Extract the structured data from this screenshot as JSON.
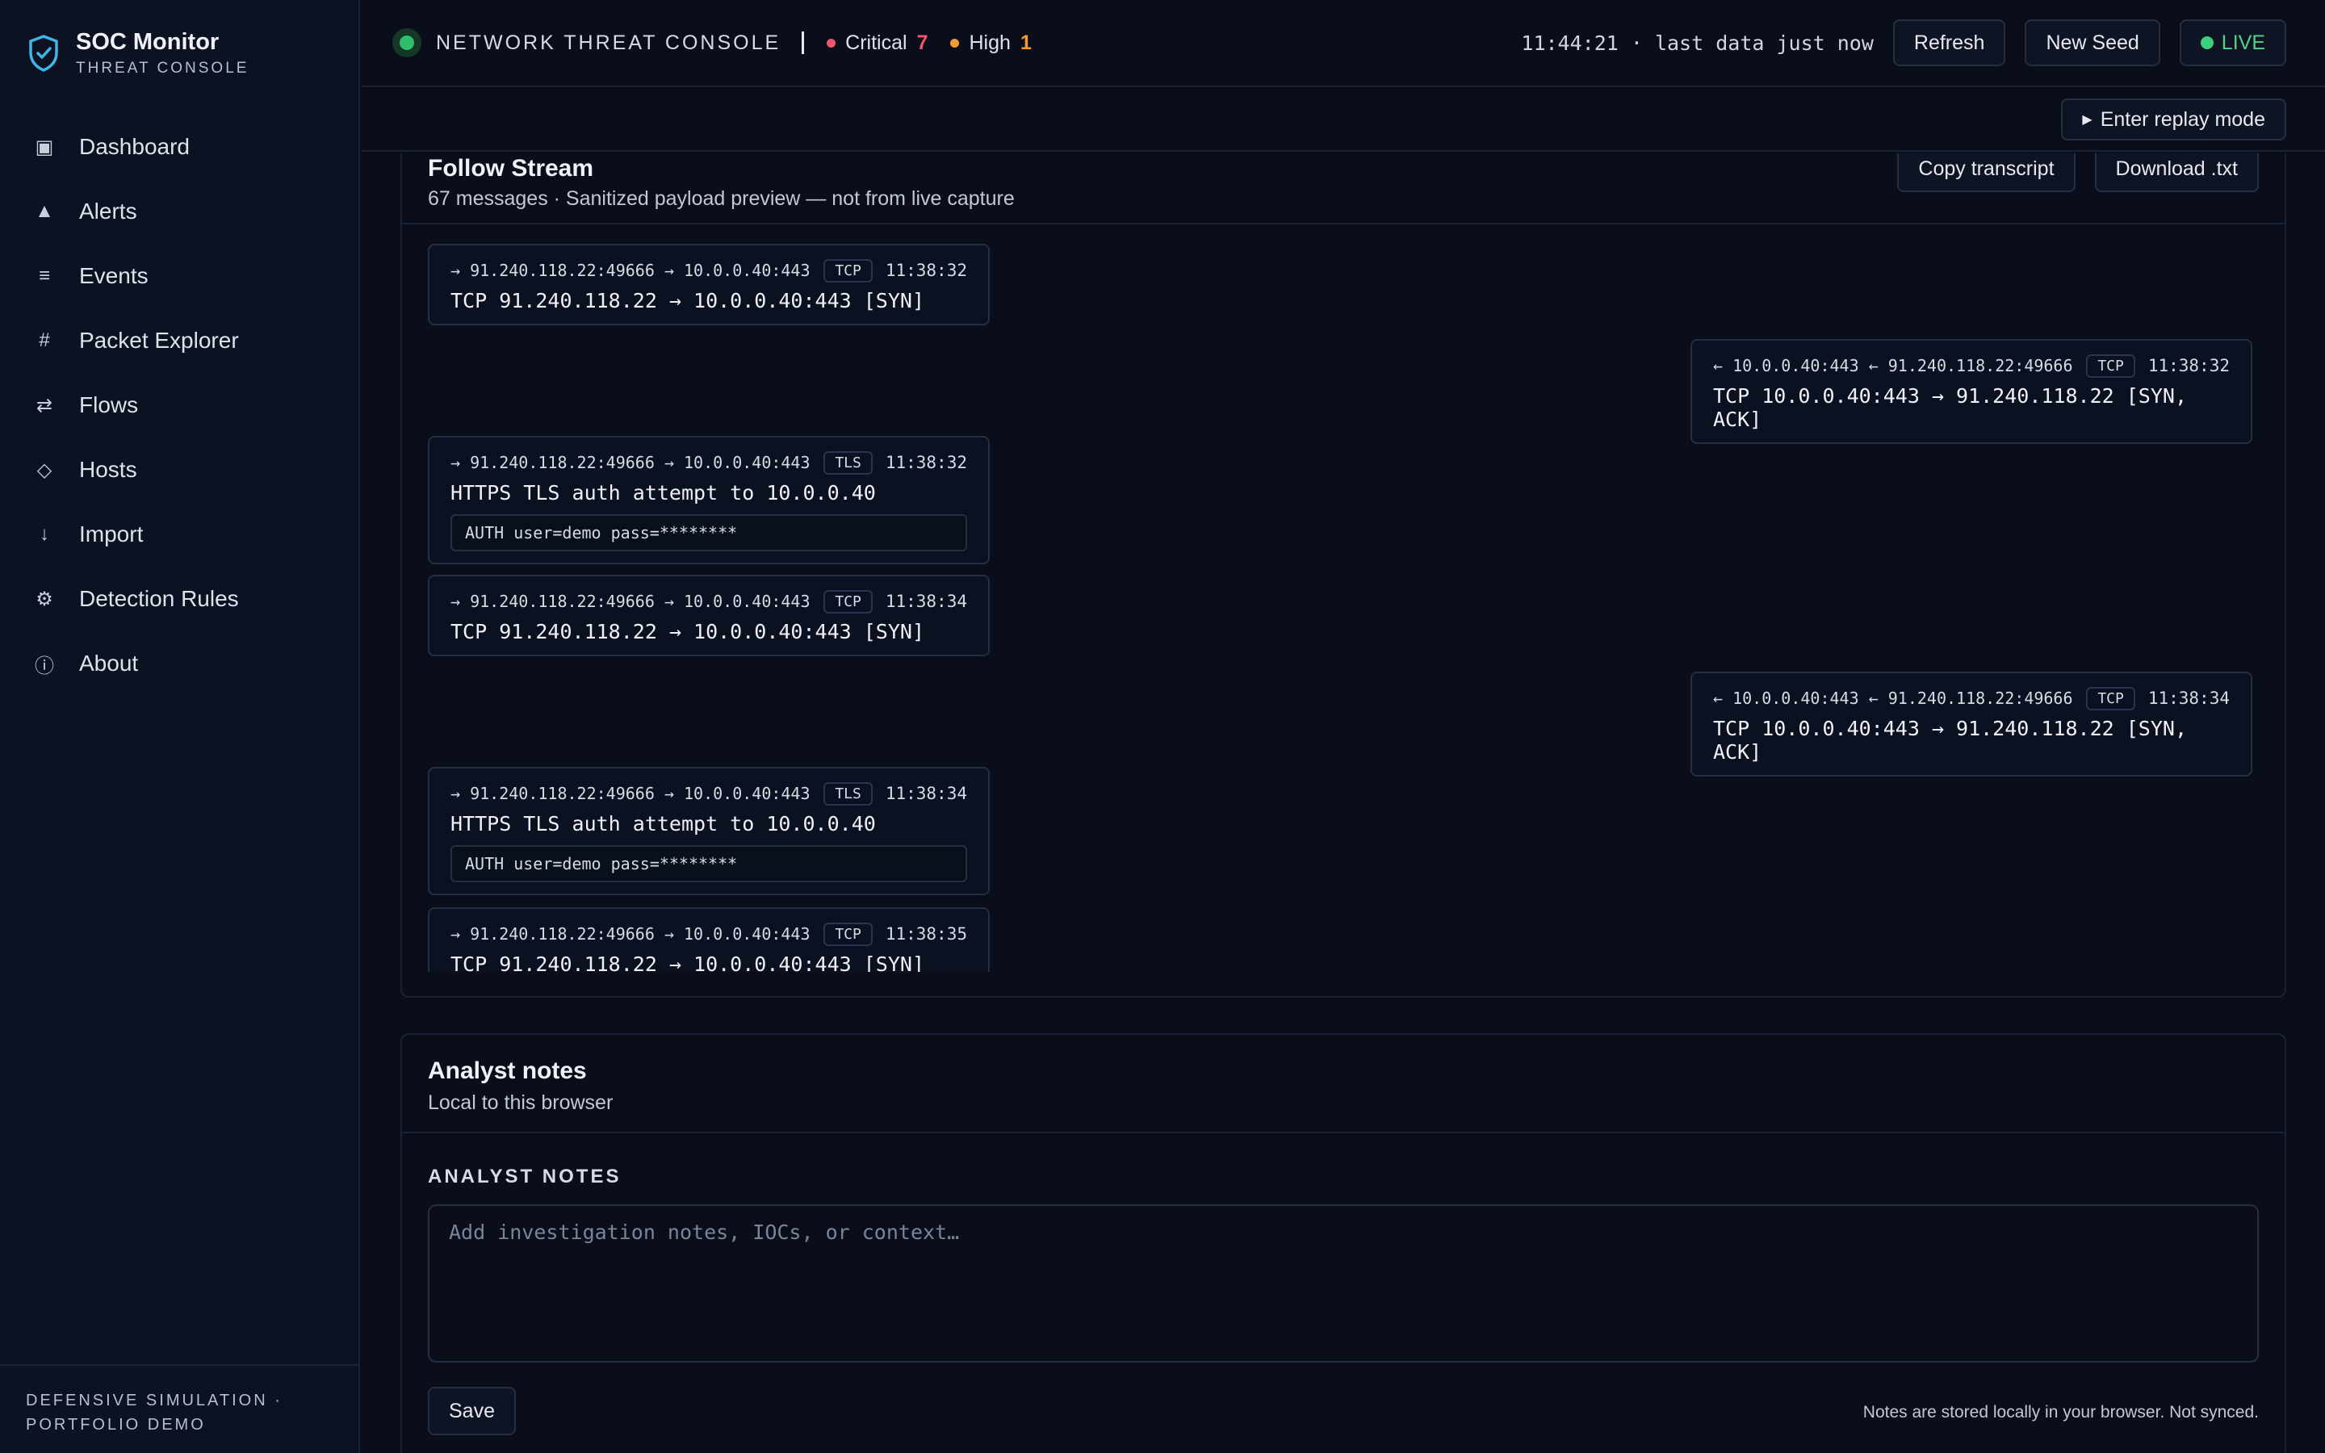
{
  "sidebar": {
    "brand_title": "SOC Monitor",
    "brand_sub": "THREAT CONSOLE",
    "items": [
      {
        "label": "Dashboard",
        "icon": "dashboard-icon"
      },
      {
        "label": "Alerts",
        "icon": "alert-triangle-icon"
      },
      {
        "label": "Events",
        "icon": "list-icon"
      },
      {
        "label": "Packet Explorer",
        "icon": "hash-icon"
      },
      {
        "label": "Flows",
        "icon": "arrows-exchange-icon"
      },
      {
        "label": "Hosts",
        "icon": "diamond-icon"
      },
      {
        "label": "Import",
        "icon": "arrow-down-icon"
      },
      {
        "label": "Detection Rules",
        "icon": "gear-icon"
      },
      {
        "label": "About",
        "icon": "info-icon"
      }
    ],
    "footer_line1": "DEFENSIVE SIMULATION ·",
    "footer_line2": "PORTFOLIO DEMO"
  },
  "topbar": {
    "title": "NETWORK THREAT CONSOLE",
    "critical_label": "Critical",
    "critical_count": "7",
    "high_label": "High",
    "high_count": "1",
    "clock": "11:44:21 · last data just now",
    "refresh_label": "Refresh",
    "new_seed_label": "New Seed",
    "live_label": "LIVE"
  },
  "replay": {
    "label": "Enter replay mode"
  },
  "stream": {
    "title": "Follow Stream",
    "subtitle": "67 messages · Sanitized payload preview — not from live capture",
    "copy_label": "Copy transcript",
    "download_label": "Download .txt",
    "messages": [
      {
        "flow": "→ 91.240.118.22:49666 → 10.0.0.40:443",
        "proto": "TCP",
        "time": "11:38:32",
        "text": "TCP 91.240.118.22 → 10.0.0.40:443 [SYN]",
        "payload": ""
      },
      {
        "flow": "← 10.0.0.40:443 ← 91.240.118.22:49666",
        "proto": "TCP",
        "time": "11:38:32",
        "text": "TCP 10.0.0.40:443 → 91.240.118.22 [SYN, ACK]",
        "payload": ""
      },
      {
        "flow": "→ 91.240.118.22:49666 → 10.0.0.40:443",
        "proto": "TLS",
        "time": "11:38:32",
        "text": "HTTPS TLS auth attempt to 10.0.0.40",
        "payload": "AUTH user=demo pass=********"
      },
      {
        "flow": "→ 91.240.118.22:49666 → 10.0.0.40:443",
        "proto": "TCP",
        "time": "11:38:34",
        "text": "TCP 91.240.118.22 → 10.0.0.40:443 [SYN]",
        "payload": ""
      },
      {
        "flow": "← 10.0.0.40:443 ← 91.240.118.22:49666",
        "proto": "TCP",
        "time": "11:38:34",
        "text": "TCP 10.0.0.40:443 → 91.240.118.22 [SYN, ACK]",
        "payload": ""
      },
      {
        "flow": "→ 91.240.118.22:49666 → 10.0.0.40:443",
        "proto": "TLS",
        "time": "11:38:34",
        "text": "HTTPS TLS auth attempt to 10.0.0.40",
        "payload": "AUTH user=demo pass=********"
      },
      {
        "flow": "→ 91.240.118.22:49666 → 10.0.0.40:443",
        "proto": "TCP",
        "time": "11:38:35",
        "text": "TCP 91.240.118.22 → 10.0.0.40:443 [SYN]",
        "payload": ""
      }
    ]
  },
  "notes": {
    "title": "Analyst notes",
    "subtitle": "Local to this browser",
    "label": "ANALYST NOTES",
    "placeholder": "Add investigation notes, IOCs, or context…",
    "save_label": "Save",
    "footer": "Notes are stored locally in your browser. Not synced."
  },
  "colors": {
    "critical": "#f2556b",
    "high": "#f59a2e",
    "live": "#3ccf7d",
    "accent": "#3fb6e8"
  }
}
